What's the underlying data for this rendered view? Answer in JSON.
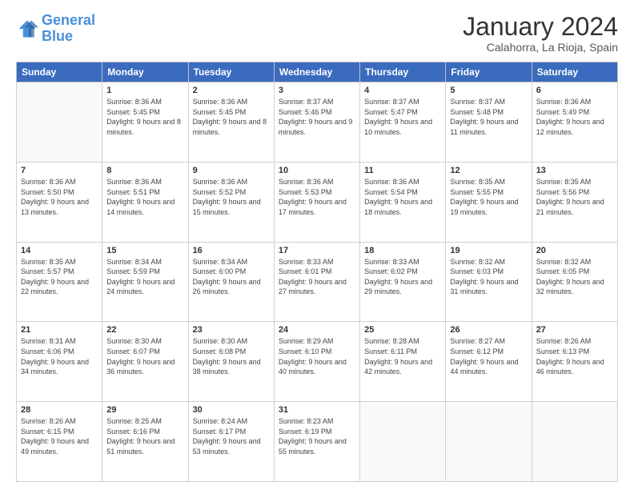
{
  "header": {
    "logo_line1": "General",
    "logo_line2": "Blue",
    "month": "January 2024",
    "location": "Calahorra, La Rioja, Spain"
  },
  "days_of_week": [
    "Sunday",
    "Monday",
    "Tuesday",
    "Wednesday",
    "Thursday",
    "Friday",
    "Saturday"
  ],
  "weeks": [
    [
      {
        "day": "",
        "sunrise": "",
        "sunset": "",
        "daylight": ""
      },
      {
        "day": "1",
        "sunrise": "Sunrise: 8:36 AM",
        "sunset": "Sunset: 5:45 PM",
        "daylight": "Daylight: 9 hours and 8 minutes."
      },
      {
        "day": "2",
        "sunrise": "Sunrise: 8:36 AM",
        "sunset": "Sunset: 5:45 PM",
        "daylight": "Daylight: 9 hours and 8 minutes."
      },
      {
        "day": "3",
        "sunrise": "Sunrise: 8:37 AM",
        "sunset": "Sunset: 5:46 PM",
        "daylight": "Daylight: 9 hours and 9 minutes."
      },
      {
        "day": "4",
        "sunrise": "Sunrise: 8:37 AM",
        "sunset": "Sunset: 5:47 PM",
        "daylight": "Daylight: 9 hours and 10 minutes."
      },
      {
        "day": "5",
        "sunrise": "Sunrise: 8:37 AM",
        "sunset": "Sunset: 5:48 PM",
        "daylight": "Daylight: 9 hours and 11 minutes."
      },
      {
        "day": "6",
        "sunrise": "Sunrise: 8:36 AM",
        "sunset": "Sunset: 5:49 PM",
        "daylight": "Daylight: 9 hours and 12 minutes."
      }
    ],
    [
      {
        "day": "7",
        "sunrise": "Sunrise: 8:36 AM",
        "sunset": "Sunset: 5:50 PM",
        "daylight": "Daylight: 9 hours and 13 minutes."
      },
      {
        "day": "8",
        "sunrise": "Sunrise: 8:36 AM",
        "sunset": "Sunset: 5:51 PM",
        "daylight": "Daylight: 9 hours and 14 minutes."
      },
      {
        "day": "9",
        "sunrise": "Sunrise: 8:36 AM",
        "sunset": "Sunset: 5:52 PM",
        "daylight": "Daylight: 9 hours and 15 minutes."
      },
      {
        "day": "10",
        "sunrise": "Sunrise: 8:36 AM",
        "sunset": "Sunset: 5:53 PM",
        "daylight": "Daylight: 9 hours and 17 minutes."
      },
      {
        "day": "11",
        "sunrise": "Sunrise: 8:36 AM",
        "sunset": "Sunset: 5:54 PM",
        "daylight": "Daylight: 9 hours and 18 minutes."
      },
      {
        "day": "12",
        "sunrise": "Sunrise: 8:35 AM",
        "sunset": "Sunset: 5:55 PM",
        "daylight": "Daylight: 9 hours and 19 minutes."
      },
      {
        "day": "13",
        "sunrise": "Sunrise: 8:35 AM",
        "sunset": "Sunset: 5:56 PM",
        "daylight": "Daylight: 9 hours and 21 minutes."
      }
    ],
    [
      {
        "day": "14",
        "sunrise": "Sunrise: 8:35 AM",
        "sunset": "Sunset: 5:57 PM",
        "daylight": "Daylight: 9 hours and 22 minutes."
      },
      {
        "day": "15",
        "sunrise": "Sunrise: 8:34 AM",
        "sunset": "Sunset: 5:59 PM",
        "daylight": "Daylight: 9 hours and 24 minutes."
      },
      {
        "day": "16",
        "sunrise": "Sunrise: 8:34 AM",
        "sunset": "Sunset: 6:00 PM",
        "daylight": "Daylight: 9 hours and 26 minutes."
      },
      {
        "day": "17",
        "sunrise": "Sunrise: 8:33 AM",
        "sunset": "Sunset: 6:01 PM",
        "daylight": "Daylight: 9 hours and 27 minutes."
      },
      {
        "day": "18",
        "sunrise": "Sunrise: 8:33 AM",
        "sunset": "Sunset: 6:02 PM",
        "daylight": "Daylight: 9 hours and 29 minutes."
      },
      {
        "day": "19",
        "sunrise": "Sunrise: 8:32 AM",
        "sunset": "Sunset: 6:03 PM",
        "daylight": "Daylight: 9 hours and 31 minutes."
      },
      {
        "day": "20",
        "sunrise": "Sunrise: 8:32 AM",
        "sunset": "Sunset: 6:05 PM",
        "daylight": "Daylight: 9 hours and 32 minutes."
      }
    ],
    [
      {
        "day": "21",
        "sunrise": "Sunrise: 8:31 AM",
        "sunset": "Sunset: 6:06 PM",
        "daylight": "Daylight: 9 hours and 34 minutes."
      },
      {
        "day": "22",
        "sunrise": "Sunrise: 8:30 AM",
        "sunset": "Sunset: 6:07 PM",
        "daylight": "Daylight: 9 hours and 36 minutes."
      },
      {
        "day": "23",
        "sunrise": "Sunrise: 8:30 AM",
        "sunset": "Sunset: 6:08 PM",
        "daylight": "Daylight: 9 hours and 38 minutes."
      },
      {
        "day": "24",
        "sunrise": "Sunrise: 8:29 AM",
        "sunset": "Sunset: 6:10 PM",
        "daylight": "Daylight: 9 hours and 40 minutes."
      },
      {
        "day": "25",
        "sunrise": "Sunrise: 8:28 AM",
        "sunset": "Sunset: 6:11 PM",
        "daylight": "Daylight: 9 hours and 42 minutes."
      },
      {
        "day": "26",
        "sunrise": "Sunrise: 8:27 AM",
        "sunset": "Sunset: 6:12 PM",
        "daylight": "Daylight: 9 hours and 44 minutes."
      },
      {
        "day": "27",
        "sunrise": "Sunrise: 8:26 AM",
        "sunset": "Sunset: 6:13 PM",
        "daylight": "Daylight: 9 hours and 46 minutes."
      }
    ],
    [
      {
        "day": "28",
        "sunrise": "Sunrise: 8:26 AM",
        "sunset": "Sunset: 6:15 PM",
        "daylight": "Daylight: 9 hours and 49 minutes."
      },
      {
        "day": "29",
        "sunrise": "Sunrise: 8:25 AM",
        "sunset": "Sunset: 6:16 PM",
        "daylight": "Daylight: 9 hours and 51 minutes."
      },
      {
        "day": "30",
        "sunrise": "Sunrise: 8:24 AM",
        "sunset": "Sunset: 6:17 PM",
        "daylight": "Daylight: 9 hours and 53 minutes."
      },
      {
        "day": "31",
        "sunrise": "Sunrise: 8:23 AM",
        "sunset": "Sunset: 6:19 PM",
        "daylight": "Daylight: 9 hours and 55 minutes."
      },
      {
        "day": "",
        "sunrise": "",
        "sunset": "",
        "daylight": ""
      },
      {
        "day": "",
        "sunrise": "",
        "sunset": "",
        "daylight": ""
      },
      {
        "day": "",
        "sunrise": "",
        "sunset": "",
        "daylight": ""
      }
    ]
  ]
}
